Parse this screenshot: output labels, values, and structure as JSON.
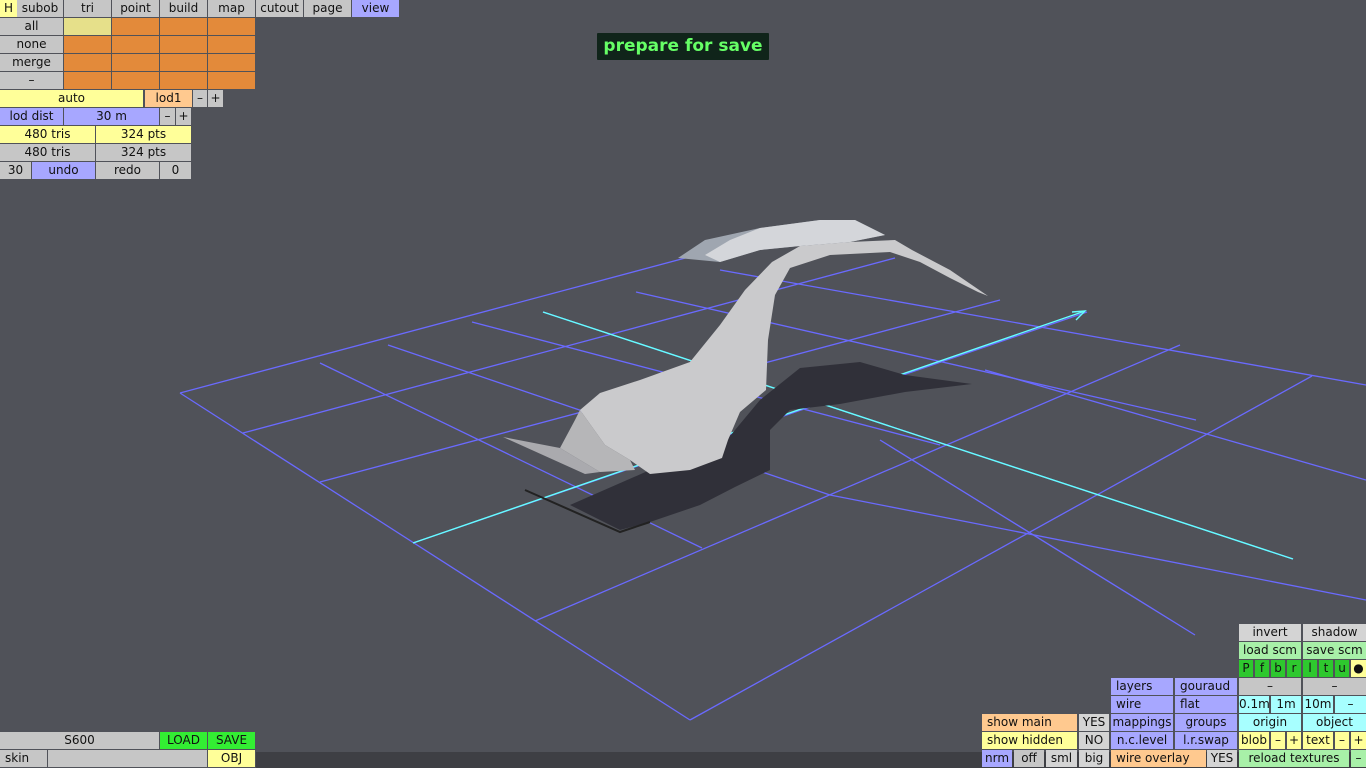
{
  "banner": "prepare for save",
  "top_tabs": {
    "h": "H",
    "subob": "subob",
    "tri": "tri",
    "point": "point",
    "build": "build",
    "map": "map",
    "cutout": "cutout",
    "page": "page",
    "view": "view"
  },
  "select_rows": [
    "all",
    "none",
    "merge",
    "–"
  ],
  "lod": {
    "auto": "auto",
    "lod1": "lod1",
    "minus": "–",
    "plus": "+",
    "lod_dist_label": "lod dist",
    "lod_dist_value": "30 m",
    "dist_minus": "–",
    "dist_plus": "+"
  },
  "stats": {
    "tris1": "480 tris",
    "pts1": "324 pts",
    "tris2": "480 tris",
    "pts2": "324 pts"
  },
  "undo_row": {
    "count": "30",
    "undo": "undo",
    "redo": "redo",
    "redo_count": "0"
  },
  "file": {
    "name": "S600",
    "load": "LOAD",
    "save": "SAVE",
    "skin": "skin",
    "obj": "OBJ"
  },
  "right_panel": {
    "invert": "invert",
    "shadow": "shadow",
    "load_scm": "load scm",
    "save_scm": "save scm",
    "flags": [
      "P",
      "f",
      "b",
      "r",
      "l",
      "t",
      "u",
      "●"
    ],
    "layers": "layers",
    "gouraud": "gouraud",
    "dash1": "–",
    "dash2": "–",
    "wire": "wire",
    "flat": "flat",
    "grid_01": "0.1m",
    "grid_1": "1m",
    "grid_10": "10m",
    "grid_minus": "–",
    "show_main": "show main",
    "show_main_val": "YES",
    "mappings": "mappings",
    "groups": "groups",
    "origin": "origin",
    "object": "object",
    "show_hidden": "show hidden",
    "show_hidden_val": "NO",
    "nc_level": "n.c.level",
    "lr_swap": "l.r.swap",
    "blob": "blob",
    "blob_minus": "–",
    "blob_plus": "+",
    "text": "text",
    "text_minus": "–",
    "text_plus": "+",
    "nrm": "nrm",
    "off": "off",
    "sml": "sml",
    "big": "big",
    "wire_overlay": "wire overlay",
    "wire_overlay_val": "YES",
    "reload_textures": "reload textures",
    "reload_minus": "–"
  },
  "colors": {
    "background": "#505259",
    "grid": "#6a6aff",
    "axis": "#66ffff",
    "model": "#c8c8ca",
    "shadow": "#303039"
  }
}
